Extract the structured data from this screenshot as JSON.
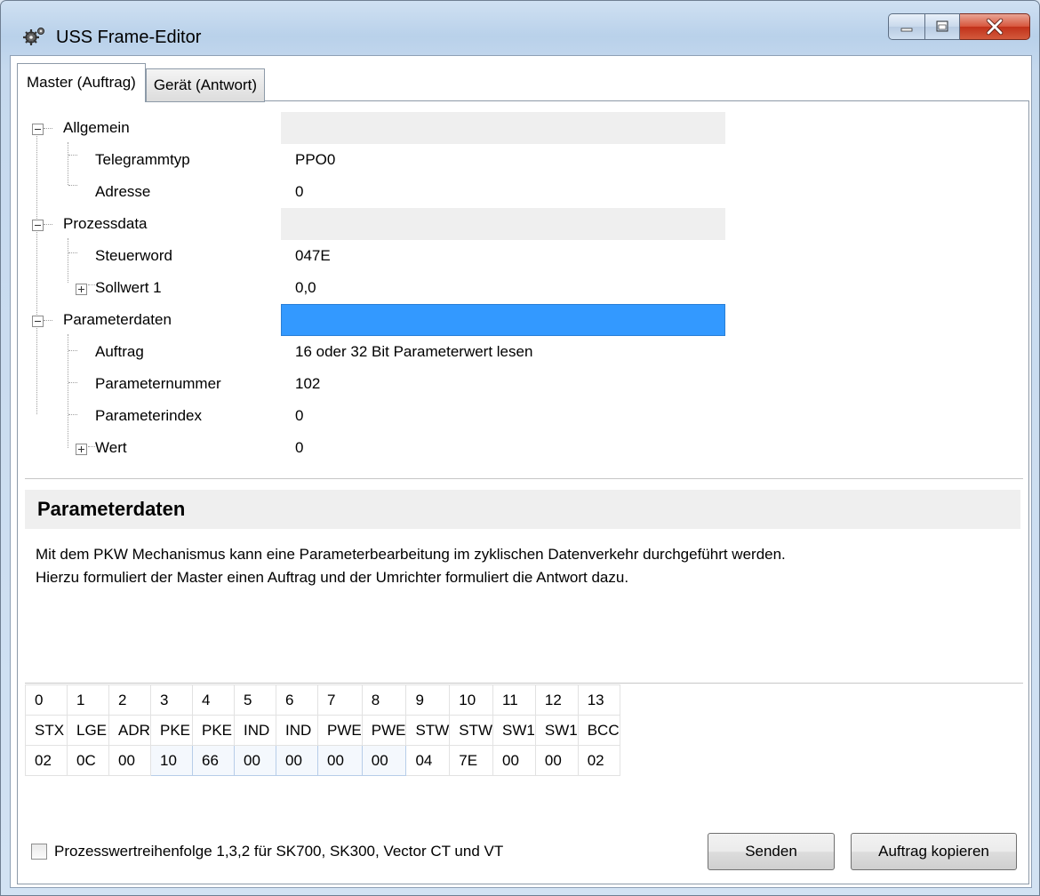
{
  "window": {
    "title": "USS Frame-Editor"
  },
  "tabs": [
    {
      "label": "Master (Auftrag)"
    },
    {
      "label": "Gerät (Antwort)"
    }
  ],
  "tree": {
    "allgemein": {
      "label": "Allgemein"
    },
    "telegrammtyp": {
      "label": "Telegrammtyp",
      "value": "PPO0"
    },
    "adresse": {
      "label": "Adresse",
      "value": "0"
    },
    "prozessdata": {
      "label": "Prozessdata"
    },
    "steuerword": {
      "label": "Steuerword",
      "value": "047E"
    },
    "sollwert1": {
      "label": "Sollwert 1",
      "value": "0,0"
    },
    "parameterdaten": {
      "label": "Parameterdaten"
    },
    "auftrag": {
      "label": "Auftrag",
      "value": "16 oder 32 Bit Parameterwert lesen"
    },
    "parameternummer": {
      "label": "Parameternummer",
      "value": "102"
    },
    "parameterindex": {
      "label": "Parameterindex",
      "value": "0"
    },
    "wert": {
      "label": "Wert",
      "value": "0"
    }
  },
  "description": {
    "title": "Parameterdaten",
    "line1": "Mit dem PKW Mechanismus kann eine Parameterbearbeitung im zyklischen Datenverkehr durchgeführt werden.",
    "line2": "Hierzu formuliert der Master einen Auftrag und der Umrichter formuliert die Antwort dazu."
  },
  "frame": {
    "indices": [
      "0",
      "1",
      "2",
      "3",
      "4",
      "5",
      "6",
      "7",
      "8",
      "9",
      "10",
      "11",
      "12",
      "13"
    ],
    "names": [
      "STX",
      "LGE",
      "ADR",
      "PKE",
      "PKE",
      "IND",
      "IND",
      "PWE",
      "PWE",
      "STW",
      "STW",
      "SW1",
      "SW1",
      "BCC"
    ],
    "bytes": [
      "02",
      "0C",
      "00",
      "10",
      "66",
      "00",
      "00",
      "00",
      "00",
      "04",
      "7E",
      "00",
      "00",
      "02"
    ]
  },
  "footer": {
    "checkbox_label": "Prozesswertreihenfolge 1,3,2 für SK700, SK300, Vector CT und VT",
    "send_button": "Senden",
    "copy_button": "Auftrag kopieren"
  }
}
